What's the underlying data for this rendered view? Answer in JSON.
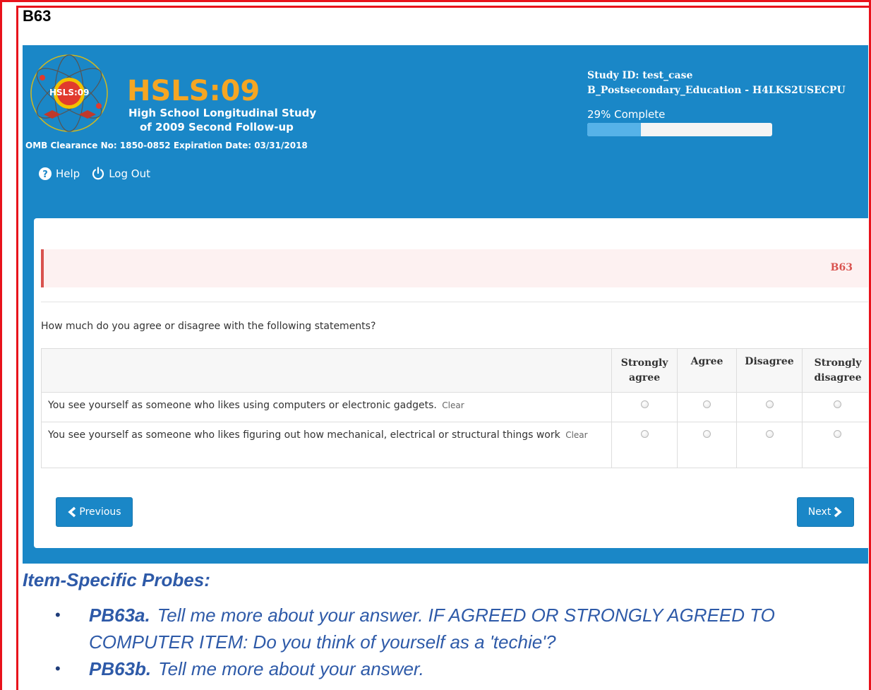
{
  "box_label": "B63",
  "brand": {
    "title": "HSLS:09",
    "subtitle_line1": "High School Longitudinal Study",
    "subtitle_line2": "of 2009 Second Follow-up",
    "omb": "OMB Clearance No: 1850-0852 Expiration Date: 03/31/2018",
    "logo_text": "HSLS:09"
  },
  "nav": {
    "help": "Help",
    "logout": "Log Out"
  },
  "study": {
    "id_line": "Study ID: test_case",
    "section_line": "B_Postsecondary_Education - H4LKS2USECPU"
  },
  "progress": {
    "label": "29% Complete",
    "fraction": 0.29
  },
  "alert": {
    "code": "B63"
  },
  "question": "How much do you agree or disagree with the following statements?",
  "table": {
    "headers": [
      {
        "line1": "Strongly",
        "line2": "agree"
      },
      {
        "line1": "Agree",
        "line2": ""
      },
      {
        "line1": "Disagree",
        "line2": ""
      },
      {
        "line1": "Strongly",
        "line2": "disagree"
      }
    ],
    "rows": [
      {
        "statement": "You see yourself as someone who likes using computers or electronic gadgets.",
        "clear": "Clear"
      },
      {
        "statement": "You see yourself as someone who likes figuring out how mechanical, electrical or structural things work",
        "clear": "Clear"
      }
    ]
  },
  "buttons": {
    "previous": "Previous",
    "next": "Next"
  },
  "probes": {
    "title": "Item-Specific Probes:",
    "items": [
      {
        "code": "PB63a.",
        "text": "Tell me more about your answer.  IF AGREED OR STRONGLY AGREED TO COMPUTER ITEM: Do you think of yourself as a 'techie'?"
      },
      {
        "code": "PB63b.",
        "text": "Tell me more about your answer."
      }
    ]
  },
  "colors": {
    "frame": "#e8121b",
    "header_bg": "#1a87c7",
    "brand_orange": "#f5a623",
    "alert_red": "#d9534f",
    "probe_blue": "#2e5aa8"
  },
  "icons": {
    "help": "question-circle-icon",
    "logout": "power-icon",
    "previous": "chevron-left-icon",
    "next": "chevron-right-icon"
  }
}
